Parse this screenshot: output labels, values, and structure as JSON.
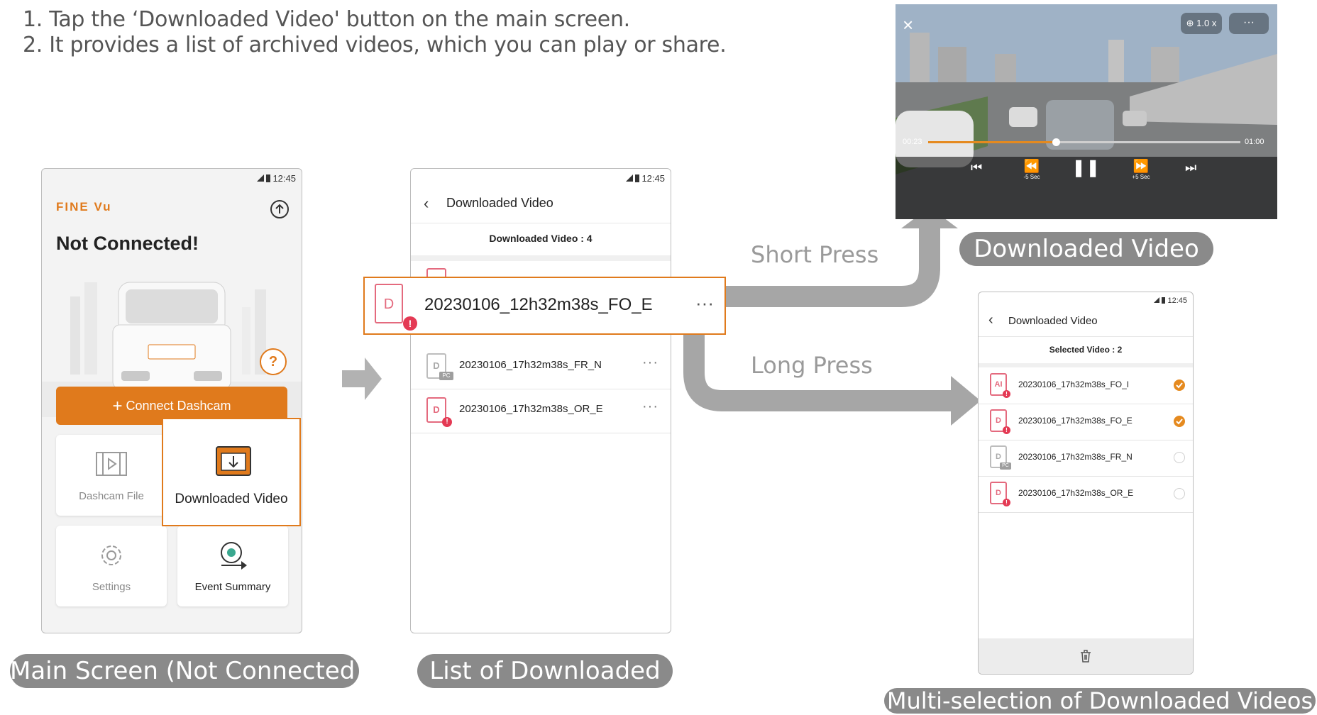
{
  "instructions": [
    "1. Tap the ‘Downloaded Video' button on the main screen.",
    "2. It provides a list of archived videos, which you can play or share."
  ],
  "main_screen": {
    "time": "12:45",
    "logo": "FINE Vu",
    "title": "Not Connected!",
    "connect_button": "Connect Dashcam",
    "help_glyph": "?",
    "tiles": {
      "dashcam_file": "Dashcam File",
      "downloaded_video": "Downloaded Video",
      "settings": "Settings",
      "event_summary": "Event Summary"
    },
    "caption": "Main Screen (Not Connected)"
  },
  "list_screen": {
    "time": "12:45",
    "title": "Downloaded Video",
    "count": "Downloaded Video : 4",
    "highlighted_item": "20230106_12h32m38s_FO_E",
    "items": [
      {
        "name": "20230106_17h32m38s_FR_N",
        "letter": "D",
        "badge": "PC"
      },
      {
        "name": "20230106_17h32m38s_OR_E",
        "letter": "D"
      }
    ],
    "caption": "List of Downloaded"
  },
  "player": {
    "zoom": "1.0 x",
    "current_time": "00:23",
    "total_time": "01:00",
    "progress": 0.41,
    "rewind_label": "-5 Sec",
    "forward_label": "+5 Sec",
    "caption": "Downloaded Video"
  },
  "arrows": {
    "short_press": "Short Press",
    "long_press": "Long Press"
  },
  "multi_screen": {
    "time": "12:45",
    "title": "Downloaded Video",
    "selected": "Selected Video : 2",
    "items": [
      {
        "name": "20230106_17h32m38s_FO_I",
        "letter": "AI",
        "checked": true
      },
      {
        "name": "20230106_17h32m38s_FO_E",
        "letter": "D",
        "checked": true
      },
      {
        "name": "20230106_17h32m38s_FR_N",
        "letter": "D",
        "checked": false,
        "badge": "PC"
      },
      {
        "name": "20230106_17h32m38s_OR_E",
        "letter": "D",
        "checked": false
      }
    ],
    "caption": "Multi-selection of Downloaded Videos"
  },
  "colors": {
    "accent": "#e07a1c",
    "caption_bg": "#8a8a8a",
    "arrow": "#a6a6a6",
    "file_icon": "#e46a7e"
  }
}
